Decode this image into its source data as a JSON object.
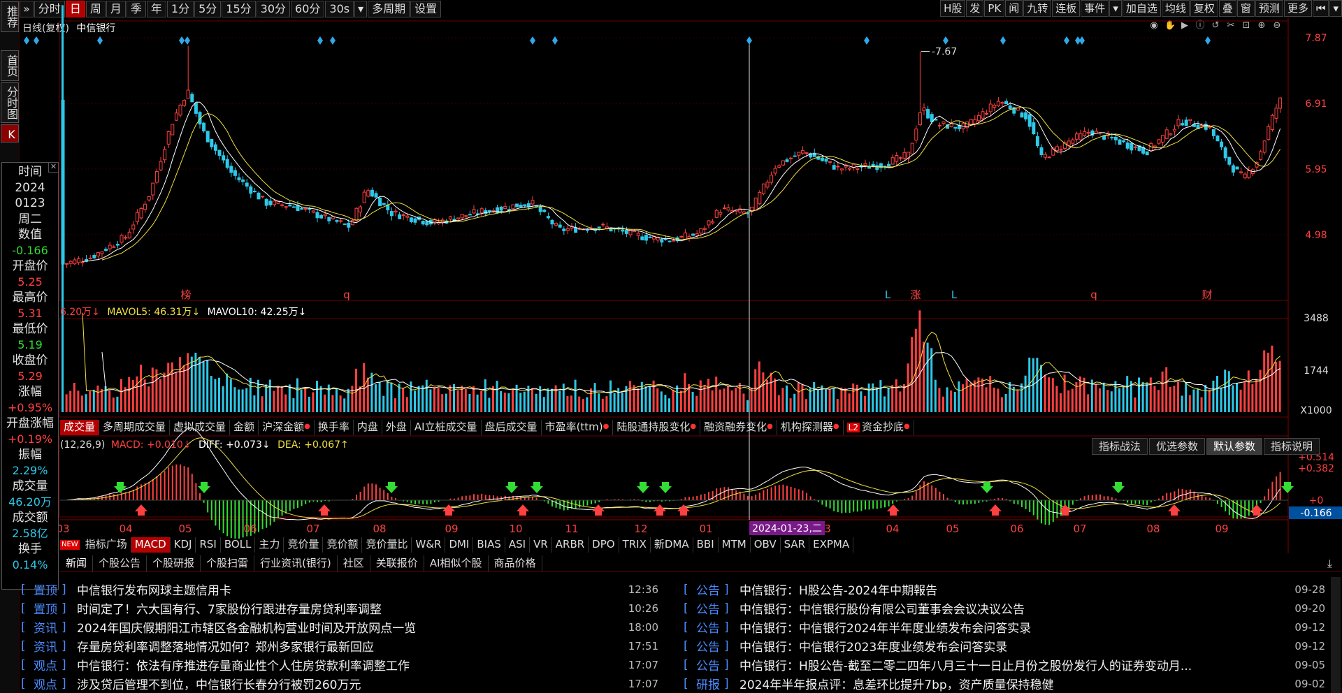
{
  "sidebar": {
    "items": [
      "推荐",
      "首页",
      "分时图",
      "K"
    ]
  },
  "toolbar": {
    "left": [
      "分时",
      "日",
      "周",
      "月",
      "季",
      "年",
      "1分",
      "5分",
      "15分",
      "30分",
      "60分",
      "30s",
      "多周期",
      "设置"
    ],
    "active": "日",
    "dropdown_after": "30s",
    "right": [
      "H股",
      "发",
      "PK",
      "闻",
      "九转",
      "连板",
      "事件",
      "加自选",
      "均线",
      "复权",
      "叠",
      "窗",
      "预测",
      "更多"
    ]
  },
  "chart_header": {
    "period": "日线(复权)",
    "stock": "中信银行"
  },
  "price_axis": [
    "7.87",
    "6.91",
    "5.95",
    "4.98"
  ],
  "max_label": "7.67",
  "event_markers": [
    {
      "text": "榜",
      "color": "#ff4040"
    },
    {
      "text": "q",
      "color": "#ff4040"
    },
    {
      "text": "L",
      "color": "#2ec8e8"
    },
    {
      "text": "涨",
      "color": "#ff4040"
    },
    {
      "text": "L",
      "color": "#2ec8e8"
    },
    {
      "text": "q",
      "color": "#ff4040"
    },
    {
      "text": "财",
      "color": "#ff4040"
    }
  ],
  "volume": {
    "legend_vol": "6.20万↓",
    "legend_ma5_label": "MAVOL5:",
    "legend_ma5": "46.31万↓",
    "legend_ma10_label": "MAVOL10:",
    "legend_ma10": "42.25万↓",
    "axis": [
      "3488",
      "1744",
      "X1000"
    ]
  },
  "vol_tabs": [
    "成交量",
    "多周期成交量",
    "虚拟成交量",
    "金额",
    "沪深金额",
    "换手率",
    "内盘",
    "外盘",
    "AI立桩成交量",
    "盘后成交量",
    "市盈率(ttm)",
    "陆股通持股变化",
    "融资融券变化",
    "机构探测器",
    "资金抄底"
  ],
  "vol_tabs_dot": [
    "沪深金额",
    "市盈率(ttm)",
    "陆股通持股变化",
    "融资融券变化",
    "机构探测器",
    "资金抄底"
  ],
  "macd": {
    "params": "(12,26,9)",
    "macd_label": "MACD:",
    "macd_val": "+0.010↓",
    "diff_label": "DIFF:",
    "diff_val": "+0.073↓",
    "dea_label": "DEA:",
    "dea_val": "+0.067↑",
    "axis": [
      "+0.514",
      "+0.382",
      "+0",
      "-0.166"
    ],
    "buttons": [
      "指标战法",
      "优选参数",
      "默认参数",
      "指标说明"
    ],
    "active_button": "默认参数"
  },
  "date_axis": [
    "03",
    "04",
    "05",
    "06",
    "07",
    "08",
    "09",
    "10",
    "11",
    "12",
    "01",
    "2024-01-23,二",
    "3",
    "04",
    "05",
    "06",
    "07",
    "08",
    "09"
  ],
  "indicator_tabs": [
    "指标广场",
    "MACD",
    "KDJ",
    "RSI",
    "BOLL",
    "主力",
    "竞价量",
    "竞价额",
    "竞价量比",
    "W&R",
    "DMI",
    "BIAS",
    "ASI",
    "VR",
    "ARBR",
    "DPO",
    "TRIX",
    "新DMA",
    "BBI",
    "MTM",
    "OBV",
    "SAR",
    "EXPMA"
  ],
  "info": {
    "time_label": "时间",
    "year": "2024",
    "date": "0123",
    "weekday": "周二",
    "value_label": "数值",
    "value": "-0.166",
    "open_label": "开盘价",
    "open": "5.25",
    "high_label": "最高价",
    "high": "5.31",
    "low_label": "最低价",
    "low": "5.19",
    "close_label": "收盘价",
    "close": "5.29",
    "chg_label": "涨幅",
    "chg": "+0.95%",
    "open_chg_label": "开盘涨幅",
    "open_chg": "+0.19%",
    "amp_label": "振幅",
    "amp": "2.29%",
    "vol_label": "成交量",
    "vol": "46.20万",
    "amt_label": "成交额",
    "amt": "2.58亿",
    "turn_label": "换手",
    "turn": "0.14%"
  },
  "news_tabs": [
    "新闻",
    "个股公告",
    "个股研报",
    "个股扫雷",
    "行业资讯(银行)",
    "社区",
    "关联报价",
    "AI相似个股",
    "商品价格"
  ],
  "news_left": [
    {
      "cat": "置顶",
      "title": "中信银行发布网球主题信用卡",
      "time": "12:36"
    },
    {
      "cat": "置顶",
      "title": "时间定了！六大国有行、7家股份行跟进存量房贷利率调整",
      "time": "10:26"
    },
    {
      "cat": "资讯",
      "title": "2024年国庆假期阳江市辖区各金融机构营业时间及开放网点一览",
      "time": "18:00"
    },
    {
      "cat": "资讯",
      "title": "存量房贷利率调整落地情况如何？郑州多家银行最新回应",
      "time": "17:51"
    },
    {
      "cat": "观点",
      "title": "中信银行：依法有序推进存量商业性个人住房贷款利率调整工作",
      "time": "17:07"
    },
    {
      "cat": "观点",
      "title": "涉及贷后管理不到位，中信银行长春分行被罚260万元",
      "time": "17:07"
    }
  ],
  "news_right": [
    {
      "cat": "公告",
      "title": "中信银行：H股公告-2024年中期報告",
      "time": "09-28"
    },
    {
      "cat": "公告",
      "title": "中信银行：中信银行股份有限公司董事会会议决议公告",
      "time": "09-20"
    },
    {
      "cat": "公告",
      "title": "中信银行：中信银行2024年半年度业绩发布会问答实录",
      "time": "09-12"
    },
    {
      "cat": "公告",
      "title": "中信银行：中信银行2023年度业绩发布会问答实录",
      "time": "09-12"
    },
    {
      "cat": "公告",
      "title": "中信银行：H股公告-截至二零二四年八月三十一日止月份之股份发行人的证券变动月...",
      "time": "09-05"
    },
    {
      "cat": "研报",
      "title": "2024年半年报点评：息差环比提升7bp，资产质量保持稳健",
      "time": "09-02"
    }
  ],
  "colors": {
    "up": "#ff4040",
    "down": "#2ec8e8",
    "accent": "#b30000",
    "ma_white": "#ffffff",
    "ma_yellow": "#f0e040",
    "tag": "#4a8cff"
  }
}
